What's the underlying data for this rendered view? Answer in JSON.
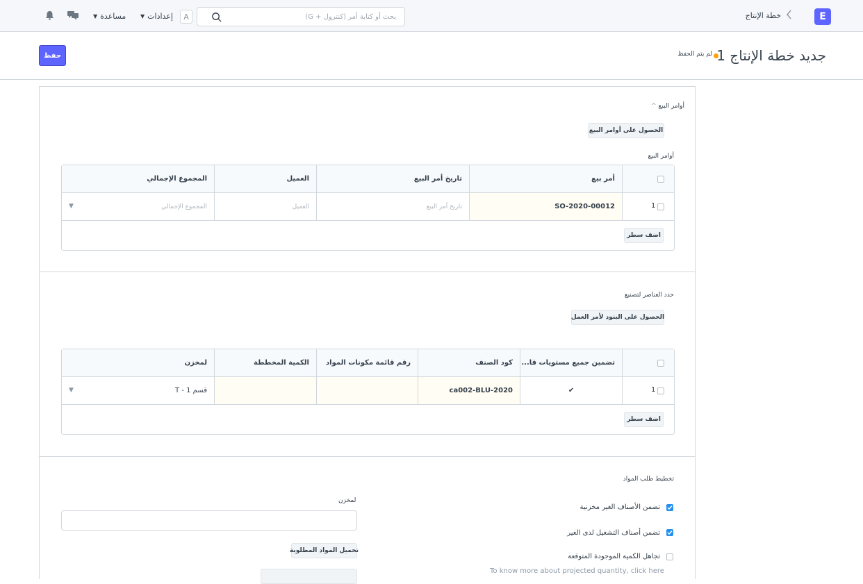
{
  "navbar": {
    "logo": "E",
    "breadcrumb": "خطة الإنتاج",
    "search_placeholder": "بحث أو كتابة أمر (كنترول + G)",
    "avatar": "A",
    "settings_label": "إعدادات",
    "help_label": "مساعدة"
  },
  "page": {
    "title": "جديد خطة الإنتاج 1",
    "status": "لم يتم الحفظ",
    "save_label": "حفظ"
  },
  "sales_orders_section": {
    "heading": "أوامر البيع",
    "get_button": "الحصول على أوامر البيع",
    "table_label": "أوامر البيع",
    "columns": [
      "أمر بيع",
      "تاريخ أمر البيع",
      "العميل",
      "المجموع الإجمالي"
    ],
    "row": {
      "index": "1",
      "sales_order": "SO-2020-00012",
      "date_placeholder": "تاريخ أمر البيع",
      "customer_placeholder": "العميل",
      "total_placeholder": "المجموع الإجمالي"
    },
    "add_row": "اضف سطر"
  },
  "items_section": {
    "heading": "حدد العناصر لتصنيع",
    "get_button": "الحصول على البنود لأمر العمل",
    "columns": [
      "تضمين جميع مستويات قا...",
      "كود الصنف",
      "رقم قائمة مكونات المواد",
      "الكمية المخططة",
      "لمخزن"
    ],
    "row": {
      "index": "1",
      "include_check": "✔",
      "item_code": "ca002-BLU-2020",
      "bom": "",
      "planned_qty": "",
      "warehouse": "قسم 1 - T"
    },
    "add_row": "اضف سطر"
  },
  "material_section": {
    "heading": "تخطيط طلب المواد",
    "warehouse_label": "لمخزن",
    "download_button": "تحميل المواد المطلوبة",
    "options": [
      {
        "label": "تضمن الأصناف الغير مخزنية",
        "checked": true
      },
      {
        "label": "تضمن أصناف التشغيل لدى الغير",
        "checked": true
      },
      {
        "label": "تجاهل الكمية الموجودة المتوقعة",
        "checked": false
      }
    ],
    "projected_note": "To know more about projected quantity, click here"
  }
}
